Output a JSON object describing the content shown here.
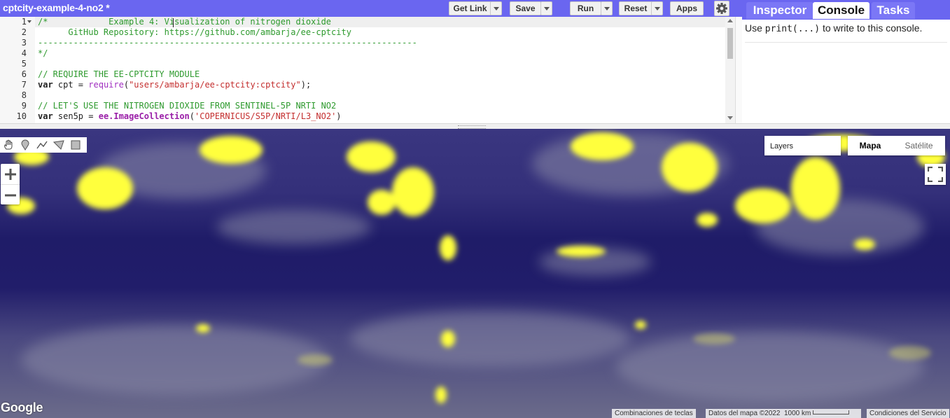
{
  "header": {
    "title": "cptcity-example-4-no2 *",
    "buttons": {
      "get_link": "Get Link",
      "save": "Save",
      "run": "Run",
      "reset": "Reset",
      "apps": "Apps"
    }
  },
  "editor": {
    "lines": [
      {
        "num": "1",
        "segments": [
          {
            "cls": "cm",
            "text": "/*            Example 4: Visualization of nitrogen dioxide"
          }
        ]
      },
      {
        "num": "2",
        "segments": [
          {
            "cls": "cm",
            "text": "      GitHub Repository: https://github.com/ambarja/ee-cptcity"
          }
        ]
      },
      {
        "num": "3",
        "segments": [
          {
            "cls": "cm",
            "text": "---------------------------------------------------------------------------"
          }
        ]
      },
      {
        "num": "4",
        "segments": [
          {
            "cls": "cm",
            "text": "*/"
          }
        ]
      },
      {
        "num": "5",
        "segments": []
      },
      {
        "num": "6",
        "segments": [
          {
            "cls": "cm",
            "text": "// REQUIRE THE EE-CPTCITY MODULE"
          }
        ]
      },
      {
        "num": "7",
        "segments": [
          {
            "cls": "kw",
            "text": "var"
          },
          {
            "cls": "",
            "text": " cpt = "
          },
          {
            "cls": "fn",
            "text": "require"
          },
          {
            "cls": "",
            "text": "("
          },
          {
            "cls": "st",
            "text": "\"users/ambarja/ee-cptcity:cptcity\""
          },
          {
            "cls": "",
            "text": ");"
          }
        ]
      },
      {
        "num": "8",
        "segments": []
      },
      {
        "num": "9",
        "segments": [
          {
            "cls": "cm",
            "text": "// LET'S USE THE NITROGEN DIOXIDE FROM SENTINEL-5P NRTI NO2"
          }
        ]
      },
      {
        "num": "10",
        "segments": [
          {
            "cls": "kw",
            "text": "var"
          },
          {
            "cls": "",
            "text": " sen5p = "
          },
          {
            "cls": "ob",
            "text": "ee.ImageCollection"
          },
          {
            "cls": "",
            "text": "("
          },
          {
            "cls": "st",
            "text": "'COPERNICUS/S5P/NRTI/L3_NO2'"
          },
          {
            "cls": "",
            "text": ")"
          }
        ]
      }
    ]
  },
  "right_panel": {
    "tabs": [
      "Inspector",
      "Console",
      "Tasks"
    ],
    "active_tab": "Console",
    "console_prefix": "Use ",
    "console_code": "print(...)",
    "console_suffix": " to write to this console."
  },
  "map": {
    "layers_label": "Layers",
    "map_types": [
      "Mapa",
      "Satélite"
    ],
    "active_map_type": "Mapa",
    "logo": "Google",
    "attribution": {
      "shortcuts": "Combinaciones de teclas",
      "map_data": "Datos del mapa ©2022",
      "scale": "1000 km",
      "terms": "Condiciones del Servicio"
    }
  },
  "colors": {
    "header_bg": "#6a66f0",
    "map_low": "#242066",
    "map_high": "#ffff3c"
  }
}
